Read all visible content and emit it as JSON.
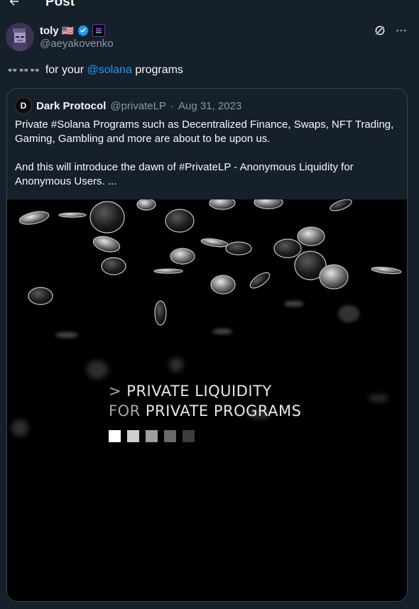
{
  "header": {
    "title": "Post"
  },
  "author": {
    "name": "toly",
    "handle": "@aeyakovenko",
    "flag": "🇺🇸"
  },
  "tweet": {
    "emojis": "👓👓👓",
    "text_before": "for your ",
    "mention": "@solana",
    "text_after": " programs"
  },
  "quote": {
    "avatar_letter": "D",
    "name": "Dark Protocol",
    "handle": "@privateLP",
    "separator": "·",
    "date": "Aug 31, 2023",
    "paragraph1": "Private #Solana Programs such as Decentralized Finance, Swaps, NFT Trading, Gaming, Gambling and more are about to be upon us.",
    "paragraph2": "And this will introduce the dawn of #PrivateLP - Anonymous Liquidity for Anonymous Users. ..."
  },
  "image": {
    "line1_prefix": "> ",
    "line1": "PRIVATE LIQUIDITY",
    "line2_prefix": "FOR ",
    "line2": "PRIVATE PROGRAMS",
    "square_colors": [
      "#ffffff",
      "#cfcfcf",
      "#9e9e9e",
      "#6a6a6a",
      "#3c3c3c"
    ]
  },
  "colors": {
    "background": "#15202b",
    "accent": "#1d9bf0",
    "muted": "#8b98a5",
    "verified": "#1d9bf0"
  }
}
